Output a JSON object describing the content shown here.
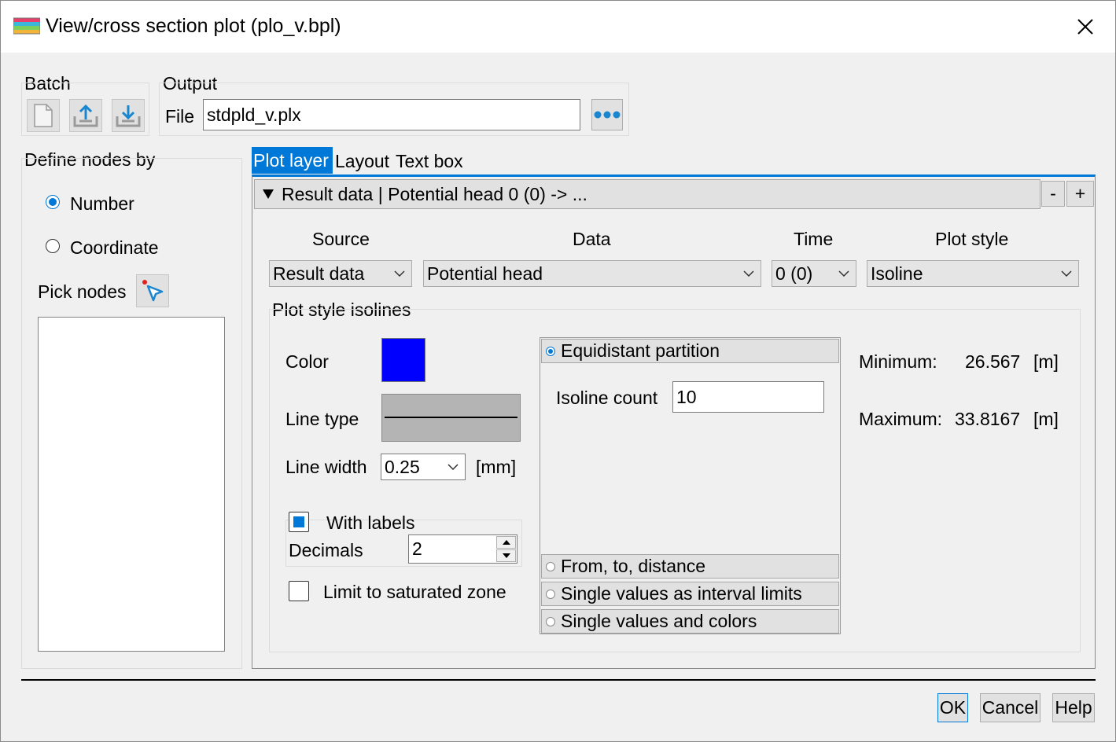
{
  "window": {
    "title": "View/cross section plot (plo_v.bpl)"
  },
  "batch": {
    "label": "Batch"
  },
  "output": {
    "label": "Output",
    "file_label": "File",
    "file_value": "stdpld_v.plx"
  },
  "define_nodes": {
    "label": "Define nodes by",
    "options": [
      "Number",
      "Coordinate"
    ],
    "selected": "Number",
    "pick_label": "Pick nodes"
  },
  "tabs": [
    "Plot layer",
    "Layout",
    "Text box"
  ],
  "active_tab": "Plot layer",
  "layer_header": {
    "text": "Result data | Potential head 0 (0) -> ...",
    "minus": "-",
    "plus": "+"
  },
  "columns": {
    "source_label": "Source",
    "source_value": "Result data",
    "data_label": "Data",
    "data_value": "Potential head",
    "time_label": "Time",
    "time_value": "0 (0)",
    "style_label": "Plot style",
    "style_value": "Isoline"
  },
  "isolines": {
    "label": "Plot style isolines",
    "color_label": "Color",
    "color_value": "#0000ff",
    "line_type_label": "Line type",
    "line_width_label": "Line width",
    "line_width_value": "0.25",
    "line_width_unit": "[mm]",
    "with_labels_label": "With labels",
    "with_labels_checked": true,
    "decimals_label": "Decimals",
    "decimals_value": "2",
    "limit_label": "Limit to saturated zone",
    "limit_checked": false
  },
  "partition": {
    "options": [
      "Equidistant partition",
      "From, to, distance",
      "Single values as interval limits",
      "Single values and colors"
    ],
    "selected": "Equidistant partition",
    "isoline_count_label": "Isoline count",
    "isoline_count_value": "10"
  },
  "range": {
    "min_label": "Minimum:",
    "min_value": "26.567",
    "min_unit": "[m]",
    "max_label": "Maximum:",
    "max_value": "33.8167",
    "max_unit": "[m]"
  },
  "footer": {
    "ok": "OK",
    "cancel": "Cancel",
    "help": "Help"
  },
  "colors": {
    "accent": "#0078d7",
    "tab_active_bg": "#0078d7"
  }
}
